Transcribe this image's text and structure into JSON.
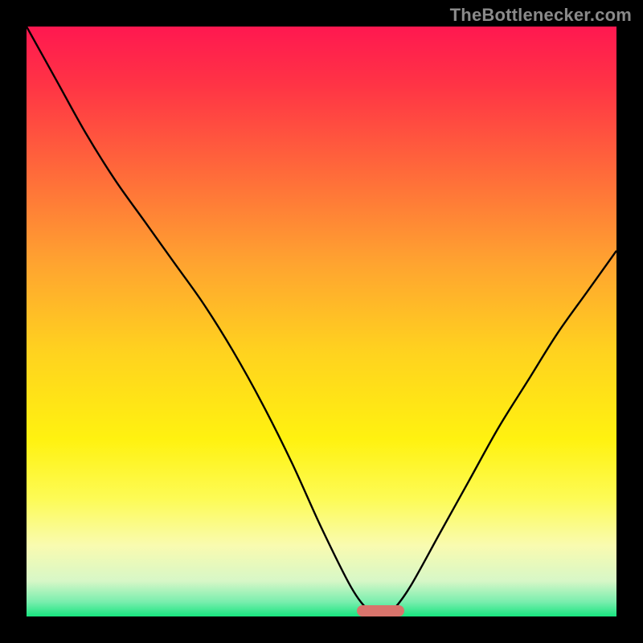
{
  "watermark": {
    "text": "TheBottlenecker.com"
  },
  "chart_data": {
    "type": "line",
    "title": "",
    "xlabel": "",
    "ylabel": "",
    "xlim": [
      0,
      100
    ],
    "ylim": [
      0,
      100
    ],
    "grid": false,
    "series": [
      {
        "name": "bottleneck-curve",
        "x": [
          0,
          5,
          10,
          15,
          20,
          25,
          30,
          35,
          40,
          45,
          50,
          55,
          58,
          60,
          62,
          65,
          70,
          75,
          80,
          85,
          90,
          95,
          100
        ],
        "y": [
          100,
          91,
          82,
          74,
          67,
          60,
          53,
          45,
          36,
          26,
          15,
          5,
          1,
          0,
          1,
          5,
          14,
          23,
          32,
          40,
          48,
          55,
          62
        ]
      }
    ],
    "marker": {
      "name": "optimal-range",
      "x_start": 56,
      "x_end": 64,
      "y": 0,
      "color": "#d9746c"
    },
    "background_gradient": {
      "stops": [
        {
          "pos": 0.0,
          "color": "#ff1850"
        },
        {
          "pos": 0.1,
          "color": "#ff3445"
        },
        {
          "pos": 0.25,
          "color": "#ff6b3a"
        },
        {
          "pos": 0.4,
          "color": "#ffa330"
        },
        {
          "pos": 0.55,
          "color": "#ffd21f"
        },
        {
          "pos": 0.7,
          "color": "#fff210"
        },
        {
          "pos": 0.8,
          "color": "#fdfb55"
        },
        {
          "pos": 0.88,
          "color": "#f9fbb0"
        },
        {
          "pos": 0.94,
          "color": "#d7f7c7"
        },
        {
          "pos": 0.975,
          "color": "#7aeeae"
        },
        {
          "pos": 1.0,
          "color": "#18e57f"
        }
      ]
    }
  }
}
